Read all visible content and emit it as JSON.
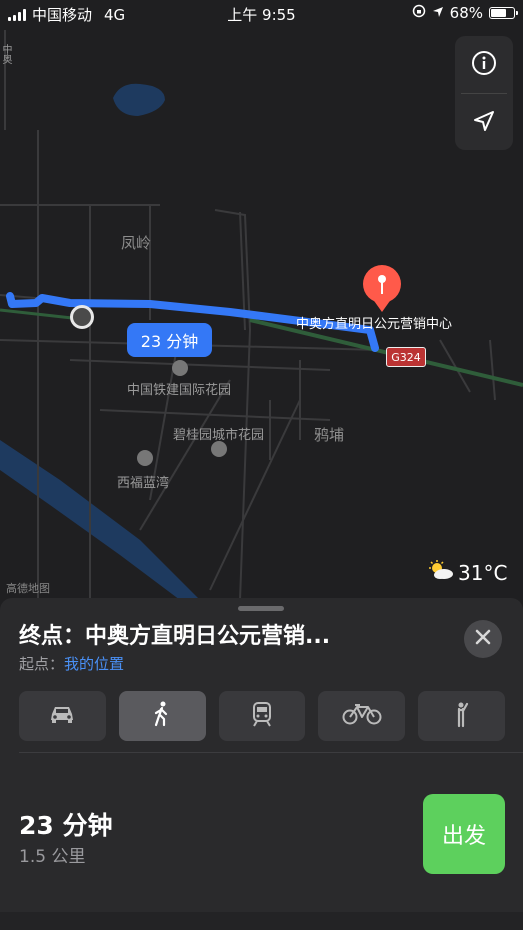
{
  "status_bar": {
    "carrier": "中国移动",
    "network": "4G",
    "time": "上午 9:55",
    "battery": "68%",
    "battery_level": 0.68
  },
  "map": {
    "labels": {
      "fengling": "凤岭",
      "destination_pin": "中奥方直明日公元营销中心",
      "zhongtie": "中国铁建国际花园",
      "biguiyuan": "碧桂园城市花园",
      "xifu": "西福蓝湾",
      "yabu": "鸦埔",
      "top_left_vertical": "中奥"
    },
    "route_time_badge": "23 分钟",
    "road_shield": "G324",
    "weather": {
      "icon": "partly-sunny-icon",
      "temperature": "31°C"
    },
    "watermark": "高德地图",
    "controls": [
      "info-icon",
      "location-arrow-icon"
    ]
  },
  "sheet": {
    "destination": "终点：中奥方直明日公元营销...",
    "origin_prefix": "起点：",
    "origin_link": "我的位置",
    "transport_modes": [
      {
        "name": "car",
        "icon": "car-icon",
        "active": false
      },
      {
        "name": "walk",
        "icon": "walking-icon",
        "active": true
      },
      {
        "name": "transit",
        "icon": "train-icon",
        "active": false
      },
      {
        "name": "bike",
        "icon": "bicycle-icon",
        "active": false
      },
      {
        "name": "ride",
        "icon": "hail-ride-icon",
        "active": false
      }
    ],
    "duration": "23 分钟",
    "distance": "1.5 公里",
    "go_label": "出发"
  },
  "colors": {
    "route": "#3478f6",
    "go_button": "#5dd05d",
    "link": "#4a90f5",
    "pin": "#ff5a4a"
  }
}
